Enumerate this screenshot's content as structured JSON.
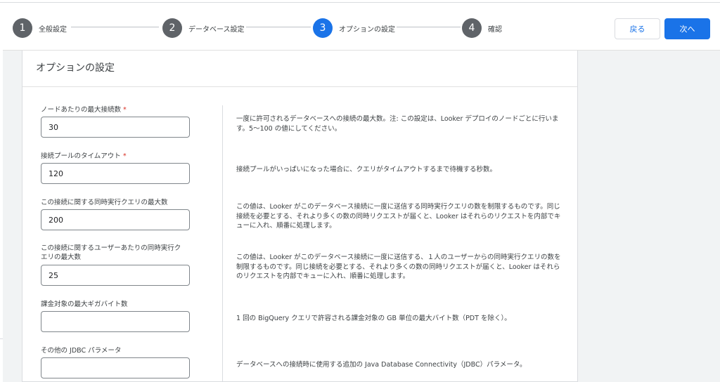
{
  "steps": [
    {
      "number": "1",
      "label": "全般設定"
    },
    {
      "number": "2",
      "label": "データベース設定"
    },
    {
      "number": "3",
      "label": "オプションの設定"
    },
    {
      "number": "4",
      "label": "確認"
    }
  ],
  "active_step": "3",
  "buttons": {
    "back": "戻る",
    "next": "次へ"
  },
  "card": {
    "title": "オプションの設定"
  },
  "fields": [
    {
      "label": "ノードあたりの最大接続数",
      "required_mark": "*",
      "value": "30",
      "description": "一度に許可されるデータベースへの接続の最大数。注: この設定は、Looker デプロイのノードごとに行います。5〜100 の値にしてください。"
    },
    {
      "label": "接続プールのタイムアウト",
      "required_mark": "*",
      "value": "120",
      "description": "接続プールがいっぱいになった場合に、クエリがタイムアウトするまで待機する秒数。"
    },
    {
      "label": "この接続に関する同時実行クエリの最大数",
      "required_mark": "",
      "value": "200",
      "description": "この値は、Looker がこのデータベース接続に一度に送信する同時実行クエリの数を制限するものです。同じ接続を必要とする、それより多くの数の同時リクエストが届くと、Looker はそれらのリクエストを内部でキューに入れ、順番に処理します。"
    },
    {
      "label": "この接続に関するユーザーあたりの同時実行クエリの最大数",
      "required_mark": "",
      "value": "25",
      "description": "この値は、Looker がこのデータベース接続に一度に送信する、１人のユーザーからの同時実行クエリの数を制限するものです。同じ接続を必要とする、それより多くの数の同時リクエストが届くと、Looker はそれらのリクエストを内部でキューに入れ、順番に処理します。"
    },
    {
      "label": "課金対象の最大ギガバイト数",
      "required_mark": "",
      "value": "",
      "description": "1 回の BigQuery クエリで許容される課金対象の GB 単位の最大バイト数（PDT を除く）。"
    },
    {
      "label": "その他の JDBC パラメータ",
      "required_mark": "",
      "value": "",
      "description": "データベースへの接続時に使用する追加の Java Database Connectivity（JDBC）パラメータ。"
    }
  ]
}
